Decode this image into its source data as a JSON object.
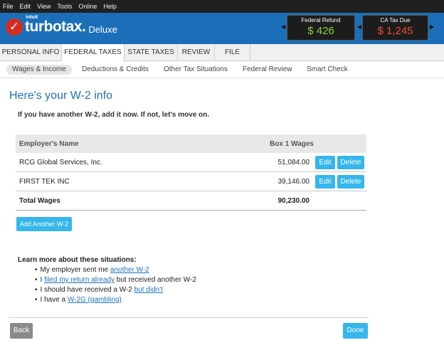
{
  "menu": [
    "File",
    "Edit",
    "View",
    "Tools",
    "Online",
    "Help"
  ],
  "brand": {
    "intuit": "intuit",
    "name": "turbotax.",
    "product": "Deluxe"
  },
  "refunds": {
    "federal": {
      "label": "Federal Refund",
      "value": "$ 426",
      "color": "#8bd43a"
    },
    "state": {
      "label": "CA Tax Due",
      "value": "$ 1,245",
      "color": "#ef4a3a"
    }
  },
  "main_tabs": [
    "PERSONAL INFO",
    "FEDERAL TAXES",
    "STATE TAXES",
    "REVIEW",
    "FILE"
  ],
  "active_main_tab": "FEDERAL TAXES",
  "sub_tabs": [
    "Wages & Income",
    "Deductions & Credits",
    "Other Tax Situations",
    "Federal Review",
    "Smart Check"
  ],
  "active_sub_tab": "Wages & Income",
  "page": {
    "title": "Here's your W-2 info",
    "instruction": "If you have another W-2, add it now. If not, let's move on."
  },
  "table": {
    "headers": {
      "employer": "Employer's Name",
      "wages": "Box 1 Wages"
    },
    "rows": [
      {
        "employer": "RCG Global Services, Inc.",
        "wages": "51,084.00",
        "edit": "Edit",
        "delete": "Delete"
      },
      {
        "employer": "FIRST TEK INC",
        "wages": "39,146.00",
        "edit": "Edit",
        "delete": "Delete"
      }
    ],
    "total": {
      "label": "Total Wages",
      "value": "90,230.00"
    }
  },
  "add_button": "Add Another W-2",
  "learn_more": {
    "title": "Learn more about these situations:",
    "items": [
      {
        "pre": "My employer sent me ",
        "link": "another W-2",
        "post": ""
      },
      {
        "pre": "I ",
        "link": "filed my return already",
        "post": " but received another W-2"
      },
      {
        "pre": "I should have received a W-2 ",
        "link": "but didn't",
        "post": ""
      },
      {
        "pre": "I have a ",
        "link": "W-2G (gambling)",
        "post": ""
      }
    ]
  },
  "footer": {
    "back": "Back",
    "done": "Done"
  },
  "colors": {
    "brand_blue": "#1b6fb8",
    "button_blue": "#35b6ec",
    "title_blue": "#1f73b7",
    "logo_red": "#d52b1e"
  }
}
